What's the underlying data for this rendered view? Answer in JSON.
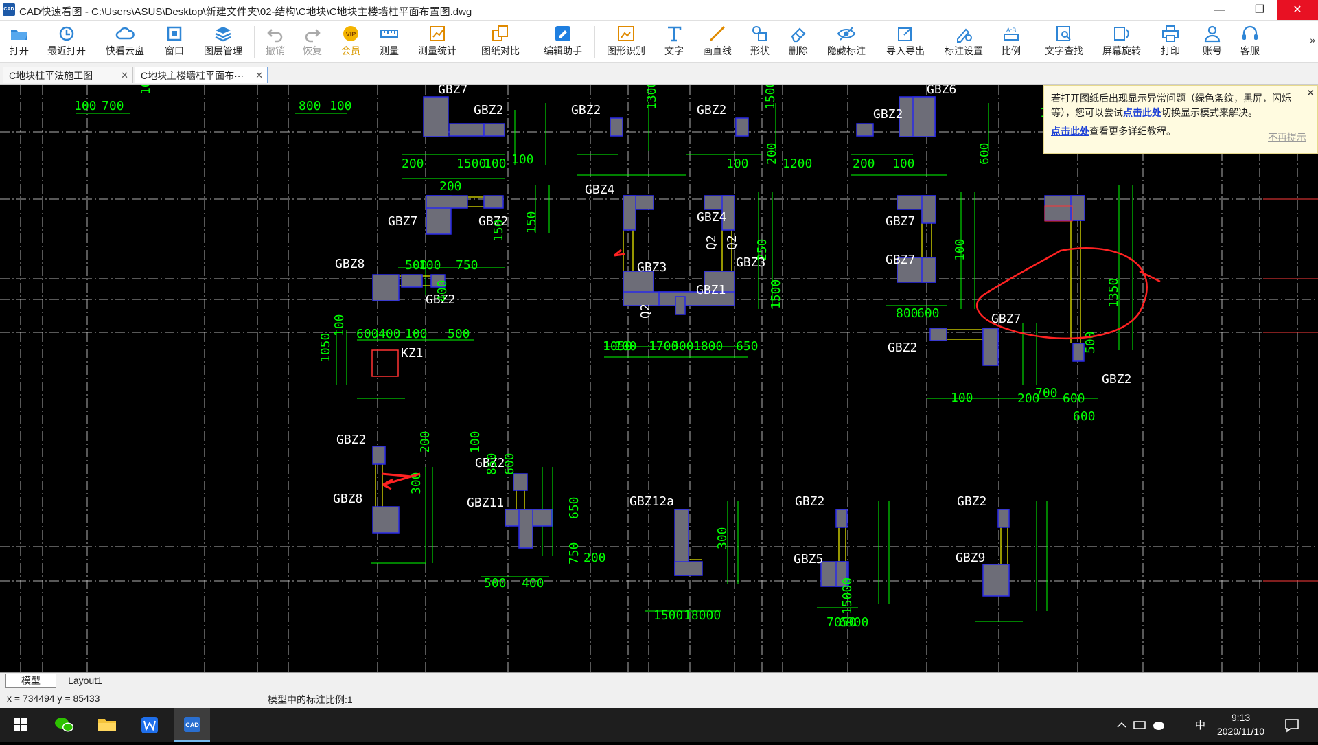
{
  "window": {
    "app_icon_text": "CAD",
    "title": "CAD快速看图 - C:\\Users\\ASUS\\Desktop\\新建文件夹\\02-结构\\C地块\\C地块主楼墙柱平面布置图.dwg",
    "minimize": "—",
    "restore": "❐",
    "close": "✕"
  },
  "toolbar": {
    "items": [
      {
        "label": "打开",
        "icon": "folder-open-icon"
      },
      {
        "label": "最近打开",
        "icon": "history-icon"
      },
      {
        "label": "快看云盘",
        "icon": "cloud-icon"
      },
      {
        "label": "窗口",
        "icon": "window-icon"
      },
      {
        "label": "图层管理",
        "icon": "layers-icon"
      },
      {
        "label": "撤销",
        "icon": "undo-icon",
        "disabled": true
      },
      {
        "label": "恢复",
        "icon": "redo-icon",
        "disabled": true
      },
      {
        "label": "会员",
        "icon": "vip-icon"
      },
      {
        "label": "测量",
        "icon": "ruler-icon"
      },
      {
        "label": "测量统计",
        "icon": "measure-stats-icon"
      },
      {
        "label": "图纸对比",
        "icon": "compare-icon"
      },
      {
        "label": "编辑助手",
        "icon": "cad-edit-icon"
      },
      {
        "label": "图形识别",
        "icon": "shape-recognize-icon"
      },
      {
        "label": "文字",
        "icon": "text-icon"
      },
      {
        "label": "画直线",
        "icon": "line-icon"
      },
      {
        "label": "形状",
        "icon": "shapes-icon"
      },
      {
        "label": "删除",
        "icon": "eraser-icon"
      },
      {
        "label": "隐藏标注",
        "icon": "hide-annotation-icon"
      },
      {
        "label": "导入导出",
        "icon": "import-export-icon"
      },
      {
        "label": "标注设置",
        "icon": "annotation-settings-icon"
      },
      {
        "label": "比例",
        "icon": "scale-icon"
      },
      {
        "label": "文字查找",
        "icon": "text-search-icon"
      },
      {
        "label": "屏幕旋转",
        "icon": "rotate-screen-icon"
      },
      {
        "label": "打印",
        "icon": "print-icon"
      },
      {
        "label": "账号",
        "icon": "account-icon"
      },
      {
        "label": "客服",
        "icon": "headset-icon"
      }
    ],
    "more": "»",
    "vip_text": "VIP"
  },
  "doc_tabs": [
    {
      "label": "C地块柱平法施工图",
      "active": false
    },
    {
      "label": "C地块主楼墙柱平面布···",
      "active": true
    }
  ],
  "tab_close": "✕",
  "notice": {
    "text1": "若打开图纸后出现显示异常问题（绿色条纹，黑屏，闪烁等），您可以尝试",
    "link1": "点击此处",
    "text2": "切换显示模式来解决。",
    "link2": "点击此处",
    "text3": "查看更多详细教程。",
    "dismiss": "不再提示",
    "close": "✕"
  },
  "drawing": {
    "labels": [
      "GBZ7",
      "GBZ2",
      "GBZ2",
      "GBZ2",
      "GBZ6",
      "GBZ2",
      "GBZ4",
      "GBZ7",
      "GBZ2",
      "GBZ4",
      "GBZ7",
      "GBZ8",
      "GBZ3",
      "GBZ3",
      "GBZ7",
      "GBZ2",
      "GBZ1",
      "Q2",
      "Q2",
      "Q2",
      "GBZ7",
      "GBZ2",
      "KZ1",
      "GBZ2",
      "GBZ2",
      "GBZ2",
      "GBZ8",
      "GBZ11",
      "GBZ12a",
      "GBZ2",
      "GBZ2",
      "GBZ5",
      "GBZ9"
    ],
    "dims": [
      "100",
      "700",
      "10",
      "800",
      "100",
      "1500",
      "200",
      "200",
      "100",
      "100",
      "1300",
      "200",
      "100",
      "1200",
      "1500",
      "200",
      "100",
      "600",
      "1400",
      "150",
      "150",
      "500",
      "100",
      "750",
      "400",
      "600",
      "400",
      "100",
      "500",
      "1050",
      "100",
      "1050",
      "100",
      "1700",
      "500",
      "1800",
      "650",
      "250",
      "1500",
      "100",
      "800",
      "600",
      "100",
      "200",
      "700",
      "600",
      "500",
      "1350",
      "600",
      "300",
      "200",
      "100",
      "850",
      "600",
      "750",
      "650",
      "200",
      "500",
      "400",
      "300",
      "1500",
      "18000",
      "7050",
      "6900",
      "15000"
    ]
  },
  "tabs_layout": {
    "model": "模型",
    "layout1": "Layout1"
  },
  "status": {
    "coords": "x = 734494  y = 85433",
    "scale": "模型中的标注比例:1"
  },
  "taskbar": {
    "items": [
      "windows-start-icon",
      "wechat-icon",
      "file-explorer-icon",
      "wps-icon",
      "cad-viewer-icon"
    ],
    "ime": "中",
    "time": "9:13",
    "date": "2020/11/10"
  },
  "colors": {
    "dim_green": "#00ff00",
    "text_white": "#ffffff",
    "column_fill": "#6d6d78",
    "column_border": "#2a2ae8",
    "wall_yellow": "#e8e800",
    "markup_red": "#ff2222",
    "grid": "#cfcfcf"
  }
}
